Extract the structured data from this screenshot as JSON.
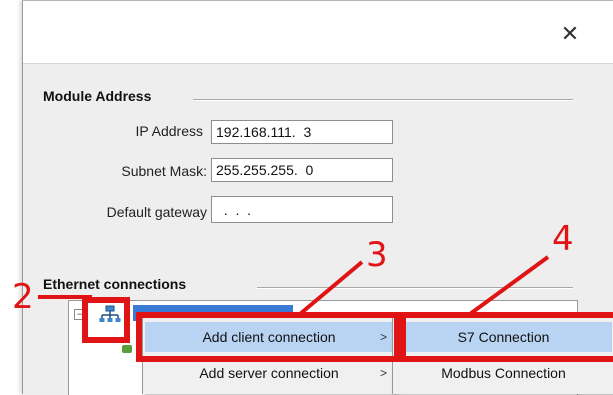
{
  "window": {
    "close_glyph": "✕"
  },
  "module_address": {
    "title": "Module Address",
    "ip_label": "IP Address",
    "ip_value": "192.168.111.  3",
    "subnet_label": "Subnet Mask:",
    "subnet_value": "255.255.255.  0",
    "gateway_label": "Default gateway",
    "gateway_value": "  .  .  ."
  },
  "ethernet": {
    "title": "Ethernet connections"
  },
  "context_menu": {
    "items": [
      {
        "label": "Add client connection",
        "arrow": ">"
      },
      {
        "label": "Add server connection",
        "arrow": ">"
      }
    ]
  },
  "submenu": {
    "items": [
      {
        "label": "S7 Connection"
      },
      {
        "label": "Modbus Connection"
      }
    ]
  },
  "annotations": {
    "n2": "2",
    "n3": "3",
    "n4": "4",
    "color": "#e01414"
  },
  "icons": {
    "network": "network-node-icon",
    "close": "close-icon",
    "expander": "collapse-icon"
  }
}
